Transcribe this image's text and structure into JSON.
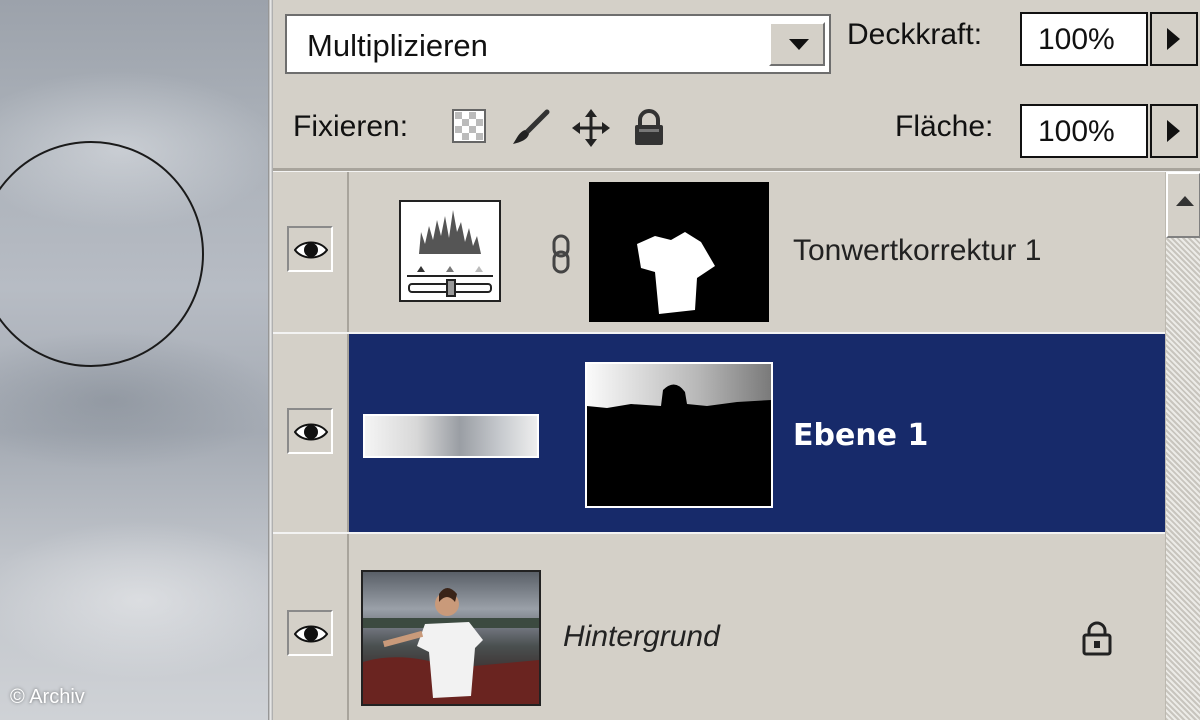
{
  "canvas": {
    "copyright": "© Archiv"
  },
  "options": {
    "blend_mode": "Multiplizieren",
    "opacity_label": "Deckkraft:",
    "opacity_value": "100%",
    "lock_label": "Fixieren:",
    "fill_label": "Fläche:",
    "fill_value": "100%",
    "lock_icons": [
      "lock-transparency-icon",
      "lock-paint-brush-icon",
      "lock-move-icon",
      "lock-all-icon"
    ]
  },
  "layers": [
    {
      "name": "Tonwertkorrektur 1",
      "type": "adjustment-levels",
      "visible": true,
      "selected": false,
      "has_mask": true
    },
    {
      "name": "Ebene 1",
      "type": "pixel",
      "visible": true,
      "selected": true,
      "has_mask": true
    },
    {
      "name": "Hintergrund",
      "type": "background",
      "visible": true,
      "selected": false,
      "locked": true
    }
  ],
  "colors": {
    "selection": "#172a6a",
    "panel": "#d4d0c8"
  }
}
